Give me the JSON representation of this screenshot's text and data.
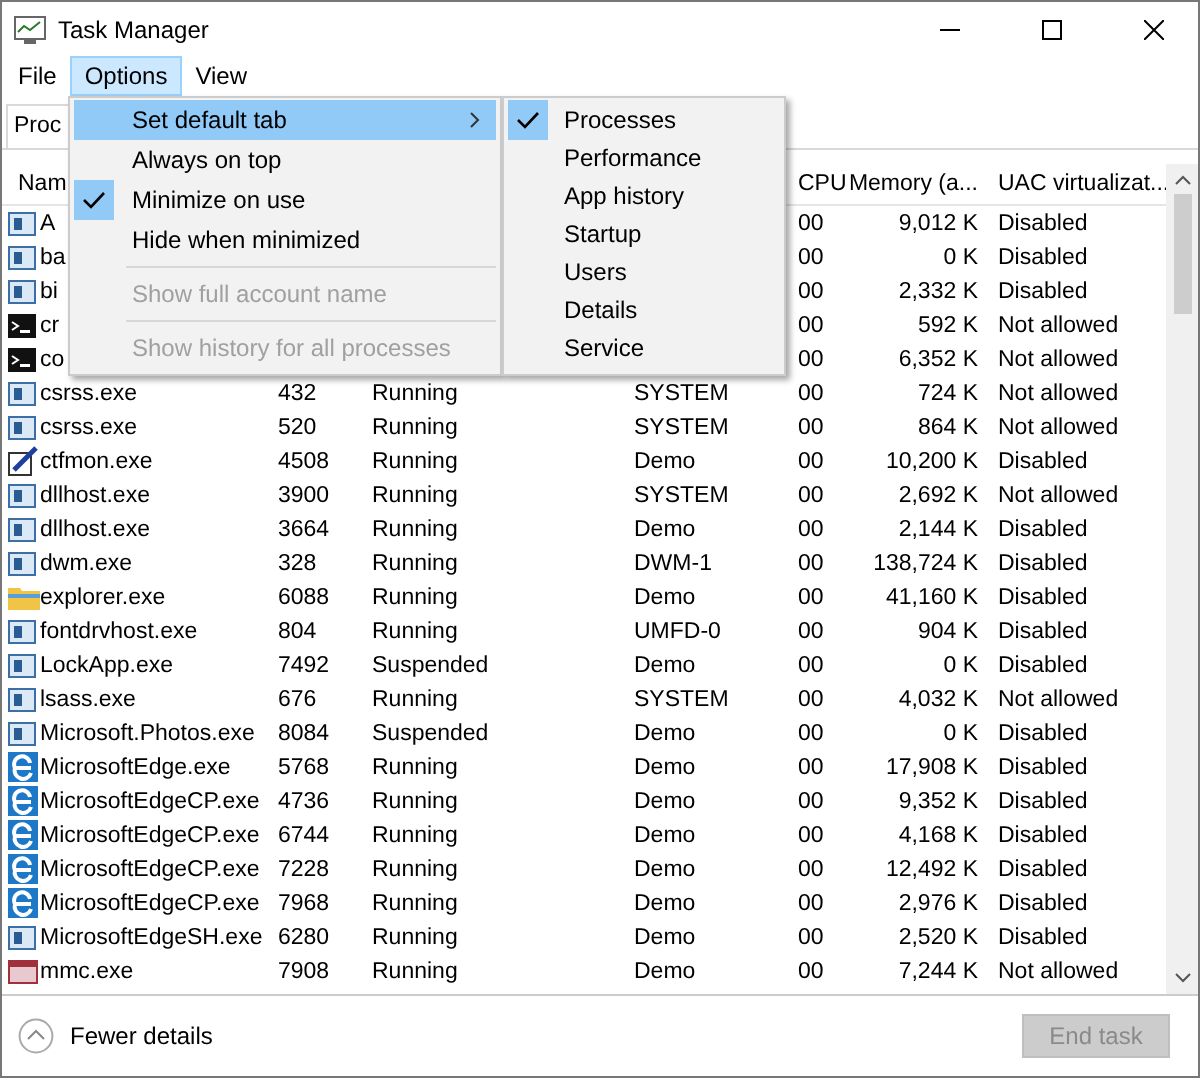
{
  "window": {
    "title": "Task Manager"
  },
  "menubar": [
    {
      "label": "File",
      "selected": false
    },
    {
      "label": "Options",
      "selected": true
    },
    {
      "label": "View",
      "selected": false
    }
  ],
  "tabs": [
    {
      "label": "Proc",
      "selected": true
    }
  ],
  "options_menu": {
    "items": [
      {
        "kind": "submenu",
        "label": "Set default tab",
        "highlighted": true,
        "checked": false,
        "disabled": false
      },
      {
        "kind": "item",
        "label": "Always on top",
        "highlighted": false,
        "checked": false,
        "disabled": false
      },
      {
        "kind": "item",
        "label": "Minimize on use",
        "highlighted": false,
        "checked": true,
        "disabled": false
      },
      {
        "kind": "item",
        "label": "Hide when minimized",
        "highlighted": false,
        "checked": false,
        "disabled": false
      },
      {
        "kind": "separator"
      },
      {
        "kind": "item",
        "label": "Show full account name",
        "highlighted": false,
        "checked": false,
        "disabled": true
      },
      {
        "kind": "separator"
      },
      {
        "kind": "item",
        "label": "Show history for all processes",
        "highlighted": false,
        "checked": false,
        "disabled": true
      }
    ]
  },
  "default_tab_submenu": {
    "items": [
      {
        "label": "Processes",
        "checked": true
      },
      {
        "label": "Performance",
        "checked": false
      },
      {
        "label": "App history",
        "checked": false
      },
      {
        "label": "Startup",
        "checked": false
      },
      {
        "label": "Users",
        "checked": false
      },
      {
        "label": "Details",
        "checked": false
      },
      {
        "label": "Service",
        "checked": false
      }
    ]
  },
  "table": {
    "header": {
      "name": "Nam",
      "cpu": "CPU",
      "memory": "Memory (a...",
      "uac": "UAC virtualizat..."
    },
    "rows": [
      {
        "kind": "app",
        "name": "A",
        "cpu": "00",
        "memory": "9,012 K",
        "uac": "Disabled"
      },
      {
        "kind": "app",
        "name": "ba",
        "cpu": "00",
        "memory": "0 K",
        "uac": "Disabled"
      },
      {
        "kind": "app",
        "name": "bi",
        "cpu": "00",
        "memory": "2,332 K",
        "uac": "Disabled"
      },
      {
        "kind": "console",
        "name": "cr",
        "cpu": "00",
        "memory": "592 K",
        "uac": "Not allowed"
      },
      {
        "kind": "console",
        "name": "co",
        "cpu": "00",
        "memory": "6,352 K",
        "uac": "Not allowed"
      },
      {
        "kind": "app",
        "name": "csrss.exe",
        "pid": "432",
        "status": "Running",
        "user": "SYSTEM",
        "cpu": "00",
        "memory": "724 K",
        "uac": "Not allowed"
      },
      {
        "kind": "app",
        "name": "csrss.exe",
        "pid": "520",
        "status": "Running",
        "user": "SYSTEM",
        "cpu": "00",
        "memory": "864 K",
        "uac": "Not allowed"
      },
      {
        "kind": "pen",
        "name": "ctfmon.exe",
        "pid": "4508",
        "status": "Running",
        "user": "Demo",
        "cpu": "00",
        "memory": "10,200 K",
        "uac": "Disabled"
      },
      {
        "kind": "app",
        "name": "dllhost.exe",
        "pid": "3900",
        "status": "Running",
        "user": "SYSTEM",
        "cpu": "00",
        "memory": "2,692 K",
        "uac": "Not allowed"
      },
      {
        "kind": "app",
        "name": "dllhost.exe",
        "pid": "3664",
        "status": "Running",
        "user": "Demo",
        "cpu": "00",
        "memory": "2,144 K",
        "uac": "Disabled"
      },
      {
        "kind": "app",
        "name": "dwm.exe",
        "pid": "328",
        "status": "Running",
        "user": "DWM-1",
        "cpu": "00",
        "memory": "138,724 K",
        "uac": "Disabled"
      },
      {
        "kind": "folder",
        "name": "explorer.exe",
        "pid": "6088",
        "status": "Running",
        "user": "Demo",
        "cpu": "00",
        "memory": "41,160 K",
        "uac": "Disabled"
      },
      {
        "kind": "app",
        "name": "fontdrvhost.exe",
        "pid": "804",
        "status": "Running",
        "user": "UMFD-0",
        "cpu": "00",
        "memory": "904 K",
        "uac": "Disabled"
      },
      {
        "kind": "app",
        "name": "LockApp.exe",
        "pid": "7492",
        "status": "Suspended",
        "user": "Demo",
        "cpu": "00",
        "memory": "0 K",
        "uac": "Disabled"
      },
      {
        "kind": "app",
        "name": "lsass.exe",
        "pid": "676",
        "status": "Running",
        "user": "SYSTEM",
        "cpu": "00",
        "memory": "4,032 K",
        "uac": "Not allowed"
      },
      {
        "kind": "app",
        "name": "Microsoft.Photos.exe",
        "pid": "8084",
        "status": "Suspended",
        "user": "Demo",
        "cpu": "00",
        "memory": "0 K",
        "uac": "Disabled"
      },
      {
        "kind": "edge",
        "name": "MicrosoftEdge.exe",
        "pid": "5768",
        "status": "Running",
        "user": "Demo",
        "cpu": "00",
        "memory": "17,908 K",
        "uac": "Disabled"
      },
      {
        "kind": "edge",
        "name": "MicrosoftEdgeCP.exe",
        "pid": "4736",
        "status": "Running",
        "user": "Demo",
        "cpu": "00",
        "memory": "9,352 K",
        "uac": "Disabled"
      },
      {
        "kind": "edge",
        "name": "MicrosoftEdgeCP.exe",
        "pid": "6744",
        "status": "Running",
        "user": "Demo",
        "cpu": "00",
        "memory": "4,168 K",
        "uac": "Disabled"
      },
      {
        "kind": "edge",
        "name": "MicrosoftEdgeCP.exe",
        "pid": "7228",
        "status": "Running",
        "user": "Demo",
        "cpu": "00",
        "memory": "12,492 K",
        "uac": "Disabled"
      },
      {
        "kind": "edge",
        "name": "MicrosoftEdgeCP.exe",
        "pid": "7968",
        "status": "Running",
        "user": "Demo",
        "cpu": "00",
        "memory": "2,976 K",
        "uac": "Disabled"
      },
      {
        "kind": "app",
        "name": "MicrosoftEdgeSH.exe",
        "pid": "6280",
        "status": "Running",
        "user": "Demo",
        "cpu": "00",
        "memory": "2,520 K",
        "uac": "Disabled"
      },
      {
        "kind": "mmc",
        "name": "mmc.exe",
        "pid": "7908",
        "status": "Running",
        "user": "Demo",
        "cpu": "00",
        "memory": "7,244 K",
        "uac": "Not allowed"
      }
    ]
  },
  "footer": {
    "details_toggle": "Fewer details",
    "end_task": {
      "label": "End task",
      "disabled": true
    }
  }
}
